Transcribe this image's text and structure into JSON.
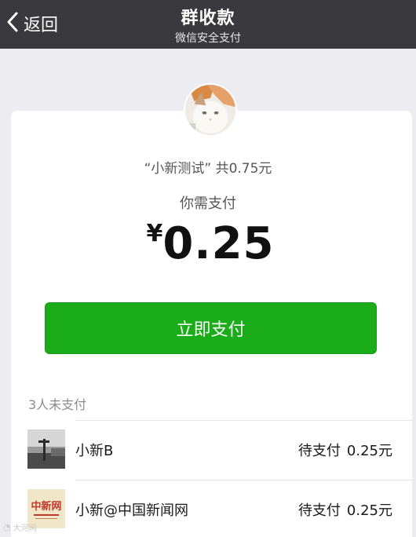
{
  "navbar": {
    "back_label": "返回",
    "title": "群收款",
    "subtitle": "微信安全支付"
  },
  "summary": {
    "text": "“小新测试” 共0.75元"
  },
  "payment": {
    "need_pay_label": "你需支付",
    "currency_symbol": "¥",
    "amount": "0.25",
    "pay_button_label": "立即支付"
  },
  "unpaid": {
    "count_label": "3人未支付",
    "members": [
      {
        "name": "小新B",
        "status": "待支付",
        "amount": "0.25元"
      },
      {
        "name": "小新@中国新闻网",
        "status": "待支付",
        "amount": "0.25元"
      }
    ]
  },
  "logo_text": "中新网",
  "watermark": "大河网",
  "colors": {
    "navbar_bg": "#3a393e",
    "page_bg": "#ececf1",
    "pay_button_green": "#1aad19",
    "logo_red": "#c0392b"
  },
  "icons": [
    "back-chevron-icon",
    "cat-avatar",
    "member-photo-avatar",
    "chinanews-logo-avatar"
  ]
}
